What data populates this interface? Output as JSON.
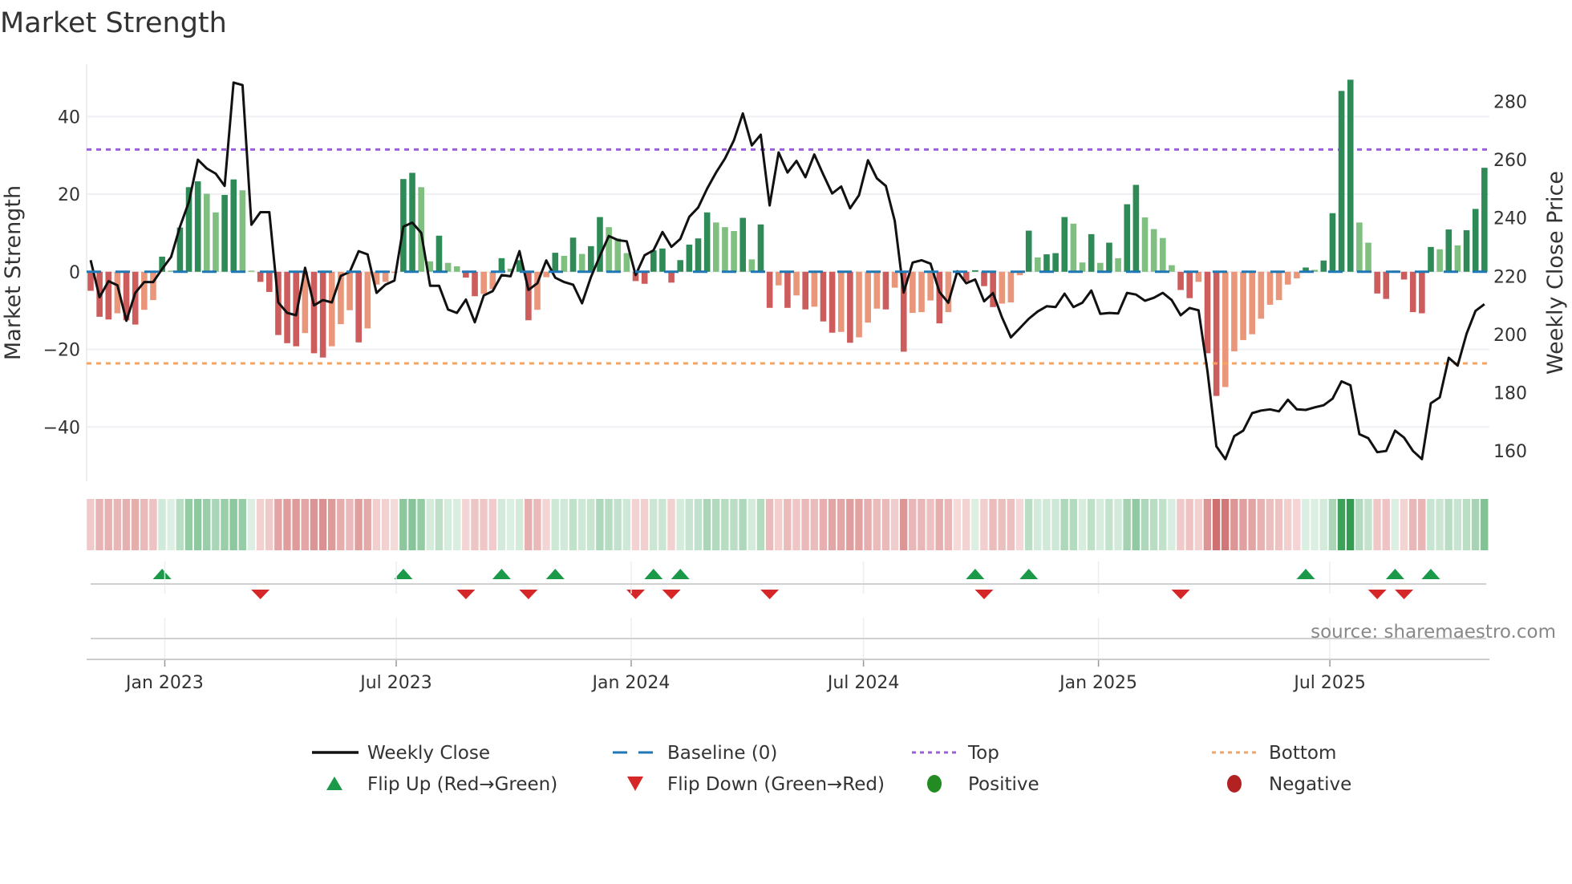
{
  "chart_data": {
    "type": "bar",
    "title": "Market Strength",
    "ylabel": "Market Strength",
    "y2label": "Weekly Close Price",
    "ylim": [
      -54,
      53.5
    ],
    "y2lim": [
      149.6,
      292.8
    ],
    "yticks": [
      40,
      20,
      0,
      -20,
      -40
    ],
    "ytick_labels": [
      "40",
      "20",
      "0",
      "−20",
      "−40"
    ],
    "y2ticks": [
      280,
      260,
      240,
      220,
      200,
      180,
      160
    ],
    "y2tick_labels": [
      "280",
      "260",
      "240",
      "220",
      "200",
      "180",
      "160"
    ],
    "xticks": [
      {
        "label": "Jan 2023",
        "at_week": 8.3
      },
      {
        "label": "Jul 2023",
        "at_week": 34.2
      },
      {
        "label": "Jan 2024",
        "at_week": 60.5
      },
      {
        "label": "Jul 2024",
        "at_week": 86.5
      },
      {
        "label": "Jan 2025",
        "at_week": 112.8
      },
      {
        "label": "Jul 2025",
        "at_week": 138.7
      }
    ],
    "top_level": 31.5,
    "bottom_level": -23.6,
    "baseline": 0,
    "strength": [
      -4.9,
      -11.6,
      -12.3,
      -10.7,
      -12.5,
      -13.6,
      -9.8,
      -7.3,
      3.9,
      0.3,
      11.4,
      21.8,
      23.3,
      20.1,
      15.3,
      19.8,
      23.8,
      21.0,
      0.3,
      -2.6,
      -5.2,
      -16.3,
      -18.4,
      -19.2,
      -15.8,
      -21.0,
      -22.1,
      -19.2,
      -13.5,
      -9.9,
      -18.2,
      -14.6,
      -3.3,
      -2.6,
      -0.3,
      23.9,
      25.5,
      21.8,
      2.7,
      9.3,
      2.3,
      1.4,
      -1.5,
      -6.3,
      -5.7,
      -4.5,
      3.5,
      0.8,
      3.0,
      -12.5,
      -9.8,
      -1.4,
      4.9,
      4.1,
      8.8,
      4.6,
      6.6,
      14.1,
      11.5,
      8.6,
      4.8,
      -2.4,
      -3.1,
      5.5,
      6.0,
      -2.8,
      3.0,
      7.0,
      8.6,
      15.3,
      12.7,
      11.5,
      10.5,
      13.9,
      3.2,
      12.2,
      -9.3,
      -3.5,
      -9.3,
      -6.1,
      -9.7,
      -9.0,
      -12.8,
      -15.7,
      -15.5,
      -18.3,
      -16.9,
      -13.1,
      -9.5,
      -9.7,
      -4.1,
      -20.6,
      -10.6,
      -10.4,
      -7.4,
      -13.3,
      -10.4,
      -0.2,
      -2.4,
      0.4,
      -3.7,
      -9.1,
      -8.2,
      -7.9,
      -0.9,
      10.6,
      3.7,
      4.5,
      4.8,
      14.1,
      12.4,
      2.4,
      9.7,
      2.3,
      7.5,
      3.5,
      17.4,
      22.4,
      14.0,
      11.0,
      8.7,
      1.7,
      -4.7,
      -6.8,
      -2.6,
      -21.0,
      -32.0,
      -29.7,
      -20.5,
      -17.6,
      -16.1,
      -12.1,
      -8.5,
      -7.3,
      -3.3,
      -1.7,
      1.1,
      0.5,
      2.9,
      15.1,
      46.6,
      49.5,
      12.7,
      7.5,
      -5.6,
      -7.0,
      0.3,
      -2.0,
      -10.4,
      -10.7,
      6.4,
      5.8,
      10.9,
      6.8,
      10.7,
      16.2,
      26.8
    ],
    "weekly_close": [
      225.5,
      212.8,
      218.3,
      216.9,
      204.7,
      214.3,
      218,
      218,
      222.5,
      226.6,
      237,
      245.5,
      260,
      257,
      255.2,
      251,
      286.5,
      285.6,
      237.7,
      242,
      242,
      211,
      207.4,
      206.6,
      222.9,
      210,
      211.8,
      211,
      220.1,
      221.5,
      228.6,
      227.5,
      214.3,
      217.1,
      218.5,
      237,
      238.4,
      234.9,
      216.7,
      216.7,
      208.6,
      207.4,
      212,
      204.2,
      213.4,
      214.9,
      220.4,
      220,
      228.6,
      215.3,
      217.6,
      225.4,
      219.5,
      218,
      217.1,
      210.7,
      219.7,
      227,
      233.8,
      232.4,
      232,
      220.4,
      227.2,
      228.9,
      235.2,
      230.1,
      232.8,
      240.4,
      243.6,
      250.1,
      255.6,
      260.4,
      266.7,
      275.9,
      264.9,
      268.6,
      244.3,
      262.5,
      255.6,
      259.6,
      254,
      261.8,
      254.9,
      248.4,
      250.8,
      243.3,
      247.8,
      259.8,
      253.6,
      251,
      239,
      214.4,
      224.7,
      225.5,
      224.3,
      214.6,
      210.9,
      221.7,
      217.6,
      218.9,
      211.4,
      214.2,
      205.9,
      199,
      202.2,
      205.4,
      207.9,
      209.7,
      209.4,
      214,
      209.4,
      210.9,
      215.1,
      207.1,
      207.4,
      207.2,
      214.3,
      213.7,
      211.6,
      212.6,
      214.3,
      211.8,
      206.6,
      209.1,
      208.3,
      187.4,
      161.6,
      157.2,
      165.1,
      167,
      173,
      173.9,
      174.3,
      173.6,
      177.6,
      174.3,
      174.1,
      175,
      175.7,
      178,
      183.9,
      182.6,
      165.8,
      164.4,
      159.6,
      160,
      167,
      164.6,
      160,
      157.2,
      176.4,
      178.4,
      192,
      189.3,
      200.3,
      208.1,
      210.4
    ],
    "legend": [
      {
        "label": "Weekly Close",
        "kind": "line"
      },
      {
        "label": "Baseline (0)",
        "kind": "dashed"
      },
      {
        "label": "Top",
        "kind": "dotted-top"
      },
      {
        "label": "Bottom",
        "kind": "dotted-bottom"
      },
      {
        "label": "Flip Up (Red→Green)",
        "kind": "triangle-up"
      },
      {
        "label": "Flip Down (Green→Red)",
        "kind": "triangle-down"
      },
      {
        "label": "Positive",
        "kind": "dot-positive"
      },
      {
        "label": "Negative",
        "kind": "dot-negative"
      }
    ],
    "legend_placement": "bottom",
    "source": "source: sharemaestro.com"
  },
  "colors": {
    "pos_strong": "#2e8b57",
    "pos_weak": "#7fbf7f",
    "neg_strong": "#cd5c5c",
    "neg_weak": "#e9967a",
    "close": "#111111",
    "baseline": "#1f77b4",
    "top": "#9b5fe0",
    "bottom": "#f4a460",
    "flip_up": "#1a9a48",
    "flip_down": "#d62728",
    "positive_dot": "#228b22",
    "negative_dot": "#b22222"
  }
}
